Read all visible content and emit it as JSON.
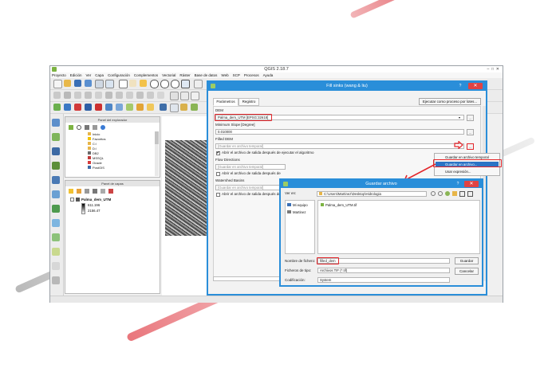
{
  "window": {
    "title": "QGIS 2.18.7"
  },
  "menu": [
    "Proyecto",
    "Edición",
    "Ver",
    "Capa",
    "Configuración",
    "Complementos",
    "Vectorial",
    "Ráster",
    "Base de datos",
    "Web",
    "SCP",
    "Procesos",
    "Ayuda"
  ],
  "browser_panel": {
    "title": "Panel del explorador",
    "items": [
      "Inicio",
      "Favoritos",
      "C:/",
      "D:/",
      "DB2",
      "MSSQL",
      "Oracle",
      "PostGIS"
    ]
  },
  "layers_panel": {
    "title": "Panel de capas",
    "layer_name": "Palma_dem_UTM",
    "max_value": "611.196",
    "min_value": "2156.47"
  },
  "fill_sinks": {
    "title": "Fill sinks (wang & liu)",
    "help": "?",
    "close": "✕",
    "tab_params": "Parámetros",
    "tab_log": "Registro",
    "batch_button": "Ejecutar como proceso por lotes...",
    "dem_label": "DEM",
    "dem_value": "Palma_dem_UTM [EPSG:32618]",
    "min_slope_label": "Minimum Slope [Degree]",
    "min_slope_value": "0.010000",
    "filled_dem_label": "Filled DEM",
    "filled_dem_placeholder": "[Guardar en archivo temporal]",
    "open_after_label": "Abrir el archivo de salida después de ejecutar el algoritmo",
    "flow_dir_label": "Flow Directions",
    "flow_dir_placeholder": "[Guardar en archivo temporal]",
    "open_after_label2": "Abrir el archivo de salida después de",
    "watershed_label": "Watershed Basins",
    "watershed_placeholder": "[Guardar en archivo temporal]",
    "open_after_label3": "Abrir el archivo de salida después de",
    "dots": "..."
  },
  "popup_menu": {
    "items": [
      "Guardar en archivo temporal",
      "Guardar en archivo...",
      "Usar expresión..."
    ],
    "selected_index": 1
  },
  "save_dialog": {
    "title": "Guardar archivo",
    "help": "?",
    "close": "✕",
    "save_in_label": "Ver en:",
    "path": "C:\\Users\\Martinez\\Desktop\\Hidrologia",
    "places": [
      "Mi equipo",
      "Martinez"
    ],
    "files": [
      "Palma_dem_UTM.tif"
    ],
    "filename_label": "Nombre de fichero:",
    "filename_value": "filled_dem",
    "filetype_label": "Ficheros de tipo:",
    "filetype_value": "Archivos TIF (*.tif)",
    "encoding_label": "Codificación:",
    "encoding_value": "System",
    "save_button": "Guardar",
    "cancel_button": "Cancelar"
  },
  "colors": {
    "dialog_blue": "#2a8ed9",
    "close_red": "#e04343",
    "highlight_red": "#e3262b",
    "selection_blue": "#2b73c5"
  }
}
